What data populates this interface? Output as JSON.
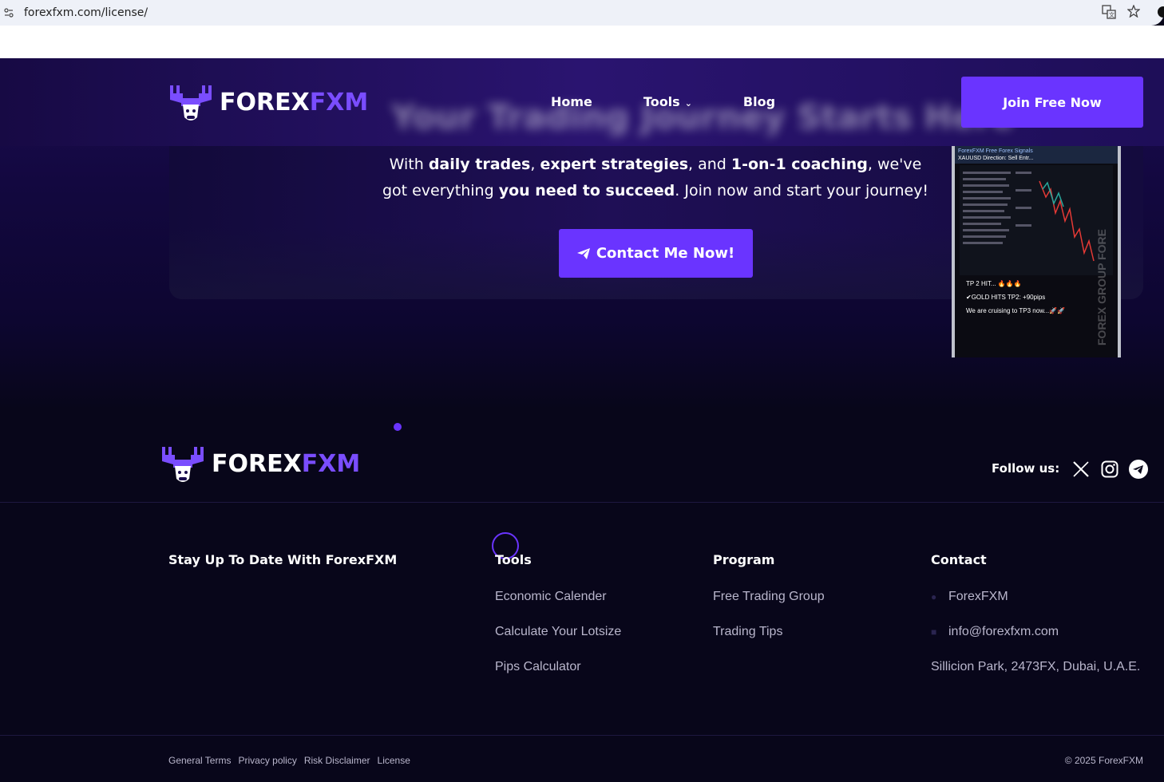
{
  "browser": {
    "url": "forexfxm.com/license/"
  },
  "brand": {
    "name_part1": "FOREX",
    "name_part2": "FXM",
    "accent": "#6a34ff"
  },
  "nav": {
    "items": [
      {
        "label": "Home"
      },
      {
        "label": "Tools"
      },
      {
        "label": "Blog"
      }
    ],
    "blurred_title": "Your Trading Journey Starts Here",
    "join_label": "Join Free Now"
  },
  "hero": {
    "t1": "With ",
    "b1": "daily trades",
    "t2": ", ",
    "b2": "expert strategies",
    "t3": ", and ",
    "b3": "1-on-1 coaching",
    "t4": ", we've got everything ",
    "b4": "you need to succeed",
    "t5": ". Join now and start your journey!",
    "contact_label": "Contact Me Now!"
  },
  "phone": {
    "header_line1": "ForexFXM Free Forex Signals",
    "header_line2": "XAUUSD  Direction: Sell Entr...",
    "msg1": "TP 2 HIT... 🔥🔥🔥",
    "msg2": "✔GOLD HITS TP2: +90pips",
    "msg3": "We are cruising to TP3 now...🚀🚀",
    "side_text": "FOREX GROUP FORE"
  },
  "footer": {
    "follow_label": "Follow us:",
    "columns": {
      "stay": {
        "title": "Stay Up To Date With ForexFXM"
      },
      "tools": {
        "title": "Tools",
        "items": [
          "Economic Calender",
          "Calculate Your Lotsize",
          "Pips Calculator"
        ]
      },
      "program": {
        "title": "Program",
        "items": [
          "Free Trading Group",
          "Trading Tips"
        ]
      },
      "contact": {
        "title": "Contact",
        "items": [
          "ForexFXM",
          "info@forexfxm.com",
          "Sillicion Park, 2473FX, Dubai, U.A.E."
        ]
      }
    },
    "legal": [
      "General Terms",
      "Privacy policy",
      "Risk Disclaimer",
      "License"
    ],
    "copyright": "© 2025 ForexFXM"
  }
}
